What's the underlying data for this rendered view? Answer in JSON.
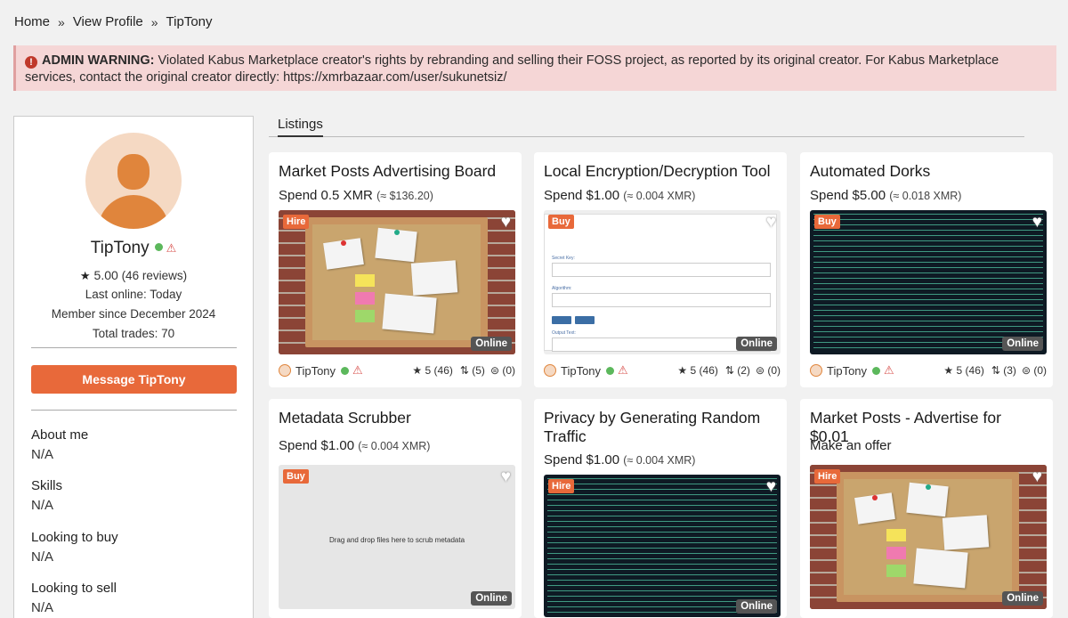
{
  "breadcrumb": {
    "home": "Home",
    "sep": "»",
    "view_profile": "View Profile",
    "current": "TipTony"
  },
  "warning": {
    "label": "ADMIN WARNING:",
    "text": " Violated Kabus Marketplace creator's rights by rebranding and selling their FOSS project, as reported by its original creator. For Kabus Marketplace services, contact the original creator directly: https://xmrbazaar.com/user/sukunetsiz/"
  },
  "profile": {
    "name": "TipTony",
    "rating": "5.00",
    "reviews": "(46 reviews)",
    "last_online": "Last online: Today",
    "member_since": "Member since December 2024",
    "total_trades": "Total trades: 70",
    "message_button": "Message TipTony",
    "about_label": "About me",
    "about_value": "N/A",
    "skills_label": "Skills",
    "skills_value": "N/A",
    "buy_label": "Looking to buy",
    "buy_value": "N/A",
    "sell_label": "Looking to sell",
    "sell_value": "N/A"
  },
  "tabs": {
    "listings": "Listings"
  },
  "colors": {
    "accent": "#e8693a",
    "online": "#5cb85c",
    "warning": "#d9534f"
  },
  "listings": [
    {
      "title": "Market Posts Advertising Board",
      "spend": "Spend 0.5 XMR",
      "approx": "(≈ $136.20)",
      "badge": "Hire",
      "status": "Online",
      "seller": "TipTony",
      "stars": "5 (46)",
      "trades": "(5)",
      "comments": "(0)"
    },
    {
      "title": "Local Encryption/Decryption Tool",
      "spend": "Spend $1.00",
      "approx": "(≈ 0.004 XMR)",
      "badge": "Buy",
      "status": "Online",
      "seller": "TipTony",
      "stars": "5 (46)",
      "trades": "(2)",
      "comments": "(0)"
    },
    {
      "title": "Automated Dorks",
      "spend": "Spend $5.00",
      "approx": "(≈ 0.018 XMR)",
      "badge": "Buy",
      "status": "Online",
      "seller": "TipTony",
      "stars": "5 (46)",
      "trades": "(3)",
      "comments": "(0)"
    },
    {
      "title": "Metadata Scrubber",
      "spend": "Spend $1.00",
      "approx": "(≈ 0.004 XMR)",
      "badge": "Buy",
      "status": "Online",
      "thumb_text": "Drag and drop files here to scrub metadata"
    },
    {
      "title": "Privacy by Generating Random Traffic",
      "spend": "Spend $1.00",
      "approx": "(≈ 0.004 XMR)",
      "badge": "Hire",
      "status": "Online"
    },
    {
      "title": "Market Posts - Advertise for $0.01",
      "spend": "Make an offer",
      "approx": "",
      "badge": "Hire",
      "status": "Online"
    }
  ]
}
